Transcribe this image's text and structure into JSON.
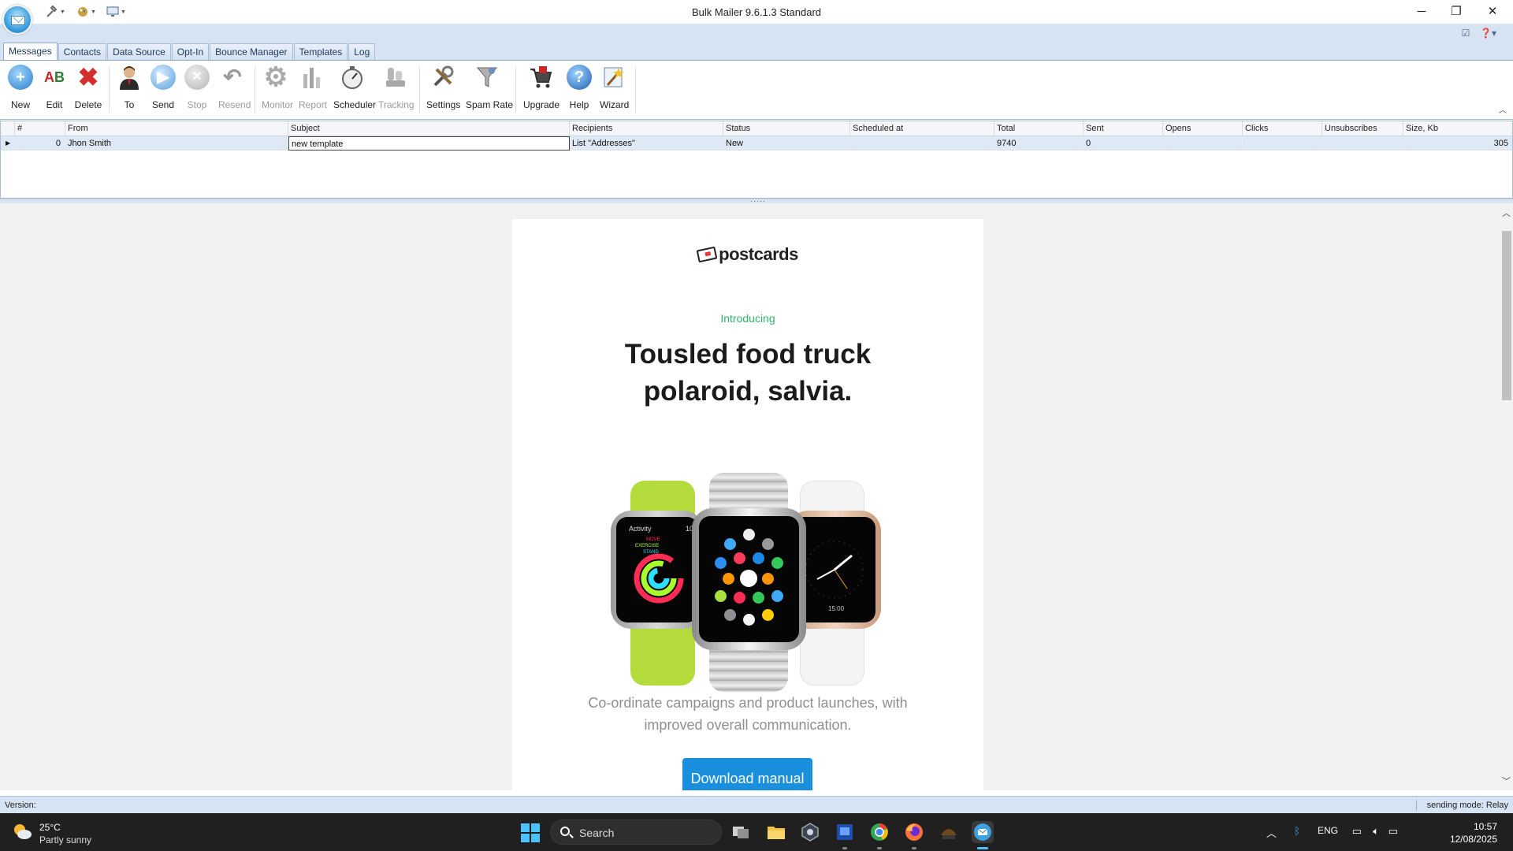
{
  "window": {
    "title": "Bulk Mailer 9.6.1.3 Standard",
    "controls": {
      "minimize": "─",
      "maximize": "❐",
      "close": "✕"
    }
  },
  "tabs": [
    "Messages",
    "Contacts",
    "Data Source",
    "Opt-In",
    "Bounce Manager",
    "Templates",
    "Log"
  ],
  "ribbon": {
    "new": "New",
    "edit": "Edit",
    "delete": "Delete",
    "to": "To",
    "send": "Send",
    "stop": "Stop",
    "resend": "Resend",
    "monitor": "Monitor",
    "report": "Report",
    "scheduler": "Scheduler",
    "tracking": "Tracking",
    "settings": "Settings",
    "spam_rate": "Spam Rate",
    "upgrade": "Upgrade",
    "help": "Help",
    "wizard": "Wizard"
  },
  "grid": {
    "columns": [
      "#",
      "From",
      "Subject",
      "Recipients",
      "Status",
      "Scheduled at",
      "Total",
      "Sent",
      "Opens",
      "Clicks",
      "Unsubscribes",
      "Size, Kb"
    ],
    "row": {
      "num": "0",
      "from": "Jhon Smith",
      "subject": "new template",
      "recipients": "List \"Addresses\"",
      "status": "New",
      "scheduled": "",
      "total": "9740",
      "sent": "0",
      "opens": "",
      "clicks": "",
      "unsubscribes": "",
      "size": "305"
    }
  },
  "preview": {
    "brand": "postcards",
    "eyebrow": "Introducing",
    "headline": "Tousled food truck polaroid, salvia.",
    "watch_left": {
      "activity": "Activity",
      "move": "MOVE",
      "exercise": "EXERCISE",
      "stand": "STAND",
      "time": "10"
    },
    "watch_right": {
      "time": "15:00"
    },
    "body": "Co-ordinate campaigns and product launches, with improved overall communication.",
    "cta": "Download manual"
  },
  "status": {
    "left": "Version:",
    "right": "sending mode: Relay"
  },
  "taskbar": {
    "weather_temp": "25°C",
    "weather_desc": "Partly sunny",
    "search": "Search",
    "lang": "ENG",
    "time": "10:57",
    "date": "12/08/2025"
  },
  "colors": {
    "accent": "#1a8fdd",
    "eyebrow": "#32b26b",
    "ribbon_bg": "#d6e3f2"
  }
}
